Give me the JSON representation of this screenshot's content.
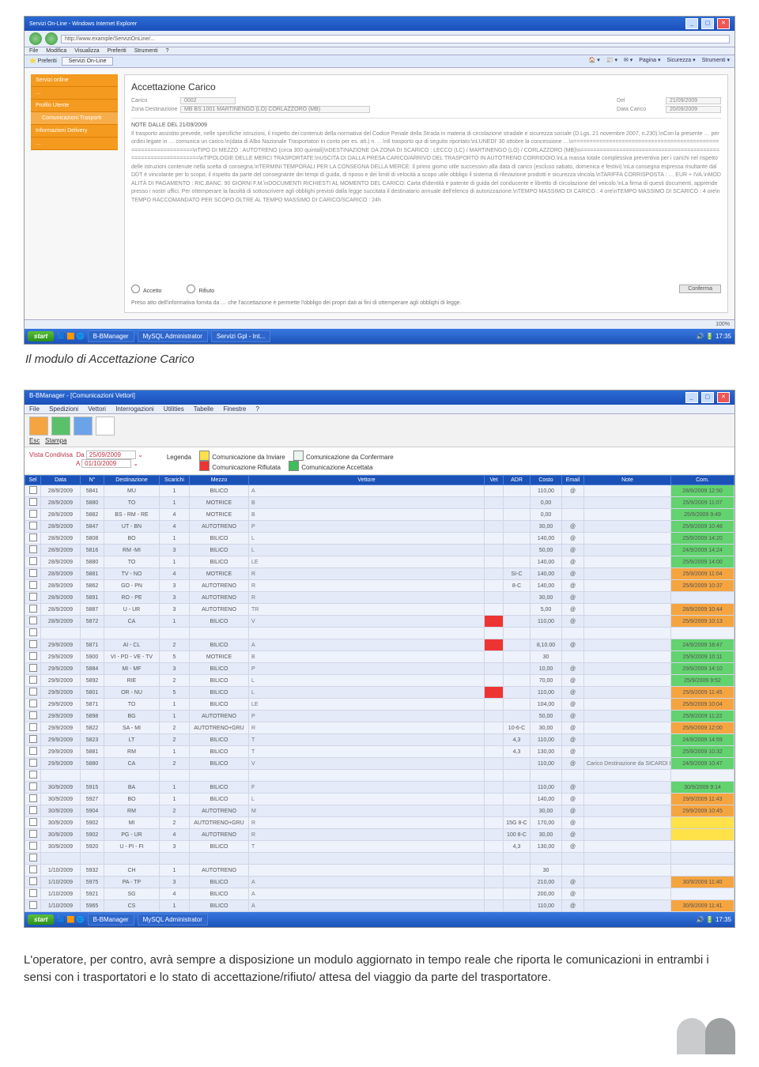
{
  "caption1": "Il modulo di Accettazione Carico",
  "bodytext": "L'operatore, per contro, avrà sempre a disposizione un modulo aggiornato in tempo reale che riporta le comunicazioni in entrambi i sensi con i trasportatori e lo stato di accettazione/rifiuto/ attesa del viaggio da parte del trasportatore.",
  "ie": {
    "title": "Servizi On-Line - Windows Internet Explorer",
    "address": "http://www.example/ServiziOnLine/...",
    "menu": [
      "File",
      "Modifica",
      "Visualizza",
      "Preferiti",
      "Strumenti",
      "?"
    ],
    "tab": "Servizi On-Line",
    "toolbar_right": [
      "Pagina ▾",
      "Sicurezza ▾",
      "Strumenti ▾"
    ],
    "status": "100%"
  },
  "sidebar": {
    "items": [
      {
        "label": "Servizi online"
      },
      {
        "label": "…"
      },
      {
        "label": "Profilo Utente"
      },
      {
        "label": "Comunicazioni Trasporti",
        "sub": true
      },
      {
        "label": "Informazioni Delivery"
      },
      {
        "label": "…"
      }
    ]
  },
  "accett": {
    "heading": "Accettazione Carico",
    "fields": {
      "carico_lbl": "Carico",
      "carico_val": "0002",
      "del_lbl": "Del",
      "del_val": "21/09/2009",
      "zona_lbl": "Zona Destinazione",
      "zona_val": "MB BS  1001  MARTINENGO  (LO)  CORLAZZORO (MB)",
      "data_lbl": "Data Carico",
      "data_val": "20/09/2009"
    },
    "note_title": "NOTE DALLE DEL 21/09/2009",
    "note_body": "Il trasporto assistito prevede, nelle specifiche istruzioni, il rispetto dei contenuti della normativa del Codice Penale della Strada in materia di circolazione stradale e sicurezza sociale (D.Lgs. 21 novembre 2007, n.230).\\nCon la presente … per ordini legate in … comunica un carico.\\n(data di Albo Nazionale Trasportatori in conto per es. att.) n. …\\nIl trasporto qui di seguito riportato:\\nLUNEDI' 30 ottobre la concessione …\\n================================================================\\nTIPO DI MEZZO : AUTOTRENO (circa 300 quintali)\\nDESTINAZIONE DA ZONA DI SCARICO : LECCO (LC) / MARTINENGO (LO) / CORLAZZORO (MB)\\n================================================================\\nTIPOLOGIE DELLE MERCI TRASPORTATE:\\nUSCITA DI DALLA PRESA CARICO/ARRIVO DEL TRASPORTO IN AUTOTRENO CORRIDOIO.\\nLa massa totale complessiva preventiva per i carichi nel rispetto delle istruzioni contenute nella scelta di consegna.\\nTERMINI TEMPORALI PER LA CONSEGNA DELLA MERCE: Il primo giorno utile successivo alla data di carico (escluso sabato, domenica e festivi).\\nLa consegna espressa risultante dal DDT è vincolante per lo scopo; il rispetto da parte del consegnante dei tempi di guida, di riposo e dei limiti di velocità a scopo utile obbligo il sistema di rilevazione prodotti e sicurezza vincola.\\nTARIFFA CORRISPOSTA : … EUR + IVA.\\nMODALITÀ DI PAGAMENTO : RIC.BANC. 90 GIORNI F.M.\\nDOCUMENTI RICHIESTI AL MOMENTO DEL CARICO: Carta d'identità e patente di guida del conducente e libretto di circolazione del veicolo.\\nLa firma di questi documenti, apprende presso i nostri uffici. Per ottemperare la facoltà di sottoscrivere agli obblighi previsti dalla legge succitata il destinatario annuale dell'elenco di autorizzazione.\\nTEMPO MASSIMO DI CARICO : 4 ore\\nTEMPO MASSIMO DI SCARICO : 4 ore\\nTEMPO RACCOMANDATO PER SCOPO OLTRE AL TEMPO MASSIMO DI CARICO/SCARICO : 24h",
    "radio_accept": "Accetto",
    "radio_reject": "Rifiuto",
    "confirm_btn": "Conferma",
    "privacy": "Preso atto dell'informativa fornita da … che l'accettazione è permette l'obbligo dei propri dati ai fini di ottemperare agli obblighi di legge."
  },
  "taskbar": {
    "start": "start",
    "items": [
      "B-BManager",
      "MySQL Administrator",
      "Servizi Gpl - Int..."
    ],
    "clock": "17:35"
  },
  "app": {
    "title": "B-BManager - [Comunicazioni Vettori]",
    "menu": [
      "File",
      "Spedizioni",
      "Vettori",
      "Interrogazioni",
      "Utilities",
      "Tabelle",
      "Finestre",
      "?"
    ],
    "esc": "Esc",
    "stampa": "Stampa",
    "filter": {
      "label": "Vista Condivisa",
      "da": "Da",
      "da_val": "25/09/2009",
      "a": "A",
      "a_val": "01/10/2009",
      "legend_lbl": "Legenda",
      "leg1": "Comunicazione da Inviare",
      "leg2": "Comunicazione da Confermare",
      "leg3": "Comunicazione Rifiutata",
      "leg4": "Comunicazione Accettata"
    },
    "columns": [
      "Sel",
      "Data",
      "N°",
      "Destinazione",
      "Scarichi",
      "Mezzo",
      "Vettore",
      "Vet",
      "ADR",
      "Costo",
      "Email",
      "Note",
      "Com."
    ],
    "rows": [
      {
        "d": "28/9/2009",
        "n": "5841",
        "dest": "MU",
        "s": "1",
        "m": "BILICO",
        "v": "A",
        "cost": "110,00",
        "email": "@",
        "com": "28/9/2009 12:50",
        "cs": "green",
        "vs": ""
      },
      {
        "d": "28/9/2009",
        "n": "5880",
        "dest": "TO",
        "s": "1",
        "m": "MOTRICE",
        "v": "B",
        "cost": "0,00",
        "email": "",
        "com": "25/9/2009 11:07",
        "cs": "green",
        "vs": ""
      },
      {
        "d": "28/9/2009",
        "n": "5882",
        "dest": "BS - RM - RE",
        "s": "4",
        "m": "MOTRICE",
        "v": "B",
        "cost": "0,00",
        "email": "",
        "com": "25/9/2009 9:49",
        "cs": "green",
        "vs": ""
      },
      {
        "d": "28/9/2009",
        "n": "5847",
        "dest": "UT - BN",
        "s": "4",
        "m": "AUTOTRENO",
        "v": "P",
        "cost": "30,00",
        "email": "@",
        "com": "25/9/2009 10:48",
        "cs": "green",
        "vs": ""
      },
      {
        "d": "28/9/2009",
        "n": "5808",
        "dest": "BO",
        "s": "1",
        "m": "BILICO",
        "v": "L",
        "cost": "140,00",
        "email": "@",
        "com": "25/9/2009 14:20",
        "cs": "green",
        "vs": ""
      },
      {
        "d": "28/9/2009",
        "n": "5816",
        "dest": "RM -MI",
        "s": "3",
        "m": "BILICO",
        "v": "L",
        "cost": "50,00",
        "email": "@",
        "com": "24/9/2009 14:24",
        "cs": "green",
        "vs": ""
      },
      {
        "d": "28/9/2009",
        "n": "5880",
        "dest": "TO",
        "s": "1",
        "m": "BILICO",
        "v": "LE",
        "cost": "140,00",
        "email": "@",
        "com": "25/9/2009 14:00",
        "cs": "green",
        "vs": ""
      },
      {
        "d": "28/9/2009",
        "n": "5881",
        "dest": "TV - NO",
        "s": "4",
        "m": "MOTRICE",
        "v": "R",
        "adr": "SI-C",
        "cost": "140,00",
        "email": "@",
        "com": "25/9/2009 11:04",
        "cs": "orange",
        "vs": ""
      },
      {
        "d": "28/9/2009",
        "n": "5862",
        "dest": "GO - PN",
        "s": "3",
        "m": "AUTOTRENO",
        "v": "R",
        "adr": "8-C",
        "cost": "140,00",
        "email": "@",
        "com": "25/9/2009 10:37",
        "cs": "orange",
        "vs": ""
      },
      {
        "d": "28/9/2009",
        "n": "5891",
        "dest": "RO - PE",
        "s": "3",
        "m": "AUTOTRENO",
        "v": "R",
        "cost": "30,00",
        "email": "@",
        "com": "",
        "cs": "",
        "vs": ""
      },
      {
        "d": "28/9/2009",
        "n": "5887",
        "dest": "U - UR",
        "s": "3",
        "m": "AUTOTRENO",
        "v": "TR",
        "cost": "5,00",
        "email": "@",
        "com": "28/9/2009 10:44",
        "cs": "orange",
        "vs": ""
      },
      {
        "d": "28/9/2009",
        "n": "5872",
        "dest": "CA",
        "s": "1",
        "m": "BILICO",
        "v": "V",
        "cost": "110,00",
        "email": "@",
        "com": "25/9/2009 10:13",
        "cs": "orange",
        "vs": "red"
      },
      {
        "sep": true
      },
      {
        "d": "29/9/2009",
        "n": "5871",
        "dest": "AI - CL",
        "s": "2",
        "m": "BILICO",
        "v": "A",
        "cost": "8,10.00",
        "email": "@",
        "com": "24/9/2009 18:47",
        "cs": "green",
        "vs": "red"
      },
      {
        "d": "29/9/2009",
        "n": "5900",
        "dest": "VI - PD - VE - TV",
        "s": "5",
        "m": "MOTRICE",
        "v": "B",
        "cost": "30",
        "email": "",
        "com": "25/9/2009 10:11",
        "cs": "green",
        "vs": ""
      },
      {
        "d": "29/9/2009",
        "n": "5884",
        "dest": "MI - MF",
        "s": "3",
        "m": "BILICO",
        "v": "P",
        "cost": "10,00",
        "email": "@",
        "com": "29/9/2009 14:10",
        "cs": "green",
        "vs": ""
      },
      {
        "d": "29/9/2009",
        "n": "5892",
        "dest": "RIE",
        "s": "2",
        "m": "BILICO",
        "v": "L",
        "cost": "70,00",
        "email": "@",
        "com": "25/9/2009 9:52",
        "cs": "green",
        "vs": ""
      },
      {
        "d": "29/9/2009",
        "n": "5801",
        "dest": "OR - NU",
        "s": "5",
        "m": "BILICO",
        "v": "L",
        "cost": "110,00",
        "email": "@",
        "com": "25/9/2009 11:45",
        "cs": "orange",
        "vs": "red"
      },
      {
        "d": "29/9/2009",
        "n": "5871",
        "dest": "TO",
        "s": "1",
        "m": "BILICO",
        "v": "LE",
        "cost": "104,00",
        "email": "@",
        "com": "25/9/2009 10:04",
        "cs": "orange",
        "vs": ""
      },
      {
        "d": "29/9/2009",
        "n": "5898",
        "dest": "BG",
        "s": "1",
        "m": "AUTOTRENO",
        "v": "P",
        "cost": "50,00",
        "email": "@",
        "com": "25/9/2009 11:22",
        "cs": "green",
        "vs": ""
      },
      {
        "d": "29/9/2009",
        "n": "5822",
        "dest": "SA - MI",
        "s": "2",
        "m": "AUTOTRENO+GRU",
        "v": "R",
        "adr": "10-6-C",
        "cost": "30,00",
        "email": "@",
        "com": "25/9/2009 12:00",
        "cs": "orange",
        "vs": ""
      },
      {
        "d": "29/9/2009",
        "n": "5823",
        "dest": "LT",
        "s": "2",
        "m": "BILICO",
        "v": "T",
        "adr": "4,3",
        "cost": "110,00",
        "email": "@",
        "com": "24/9/2009 14:59",
        "cs": "green",
        "vs": ""
      },
      {
        "d": "29/9/2009",
        "n": "5881",
        "dest": "RM",
        "s": "1",
        "m": "BILICO",
        "v": "T",
        "adr": "4,3",
        "cost": "130,00",
        "email": "@",
        "com": "25/9/2009 10:32",
        "cs": "green",
        "vs": ""
      },
      {
        "d": "29/9/2009",
        "n": "5880",
        "dest": "CA",
        "s": "2",
        "m": "BILICO",
        "v": "V",
        "cost": "110,00",
        "email": "@",
        "note": "Carico Destinazione da SICARDI R c…",
        "com": "24/9/2009 10:47",
        "cs": "green",
        "vs": ""
      },
      {
        "sep": true
      },
      {
        "d": "30/9/2009",
        "n": "5915",
        "dest": "BA",
        "s": "1",
        "m": "BILICO",
        "v": "F",
        "cost": "110,00",
        "email": "@",
        "com": "30/9/2009 9:14",
        "cs": "green",
        "vs": ""
      },
      {
        "d": "30/9/2009",
        "n": "5927",
        "dest": "BO",
        "s": "1",
        "m": "BILICO",
        "v": "L",
        "cost": "140,00",
        "email": "@",
        "com": "29/9/2009 11:43",
        "cs": "orange",
        "vs": ""
      },
      {
        "d": "30/9/2009",
        "n": "5904",
        "dest": "RM",
        "s": "2",
        "m": "AUTOTRENO",
        "v": "M",
        "cost": "30,00",
        "email": "@",
        "com": "29/9/2009 10:45",
        "cs": "orange",
        "vs": ""
      },
      {
        "d": "30/9/2009",
        "n": "5902",
        "dest": "MI",
        "s": "2",
        "m": "AUTOTRENO+GRU",
        "v": "R",
        "adr": "15G 8-C",
        "cost": "170,00",
        "email": "@",
        "com": "",
        "cs": "yellow",
        "vs": ""
      },
      {
        "d": "30/9/2009",
        "n": "5902",
        "dest": "PG - UR",
        "s": "4",
        "m": "AUTOTRENO",
        "v": "R",
        "adr": "100 8-C",
        "cost": "30,00",
        "email": "@",
        "com": "",
        "cs": "yellow",
        "vs": ""
      },
      {
        "d": "30/9/2009",
        "n": "5920",
        "dest": "U - PI - FI",
        "s": "3",
        "m": "BILICO",
        "v": "T",
        "adr": "4,3",
        "cost": "130,00",
        "email": "@",
        "com": "",
        "cs": "",
        "vs": ""
      },
      {
        "sep": true
      },
      {
        "d": "1/10/2009",
        "n": "5932",
        "dest": "CH",
        "s": "1",
        "m": "AUTOTRENO",
        "v": "",
        "cost": "30",
        "email": "",
        "com": "",
        "cs": "",
        "vs": ""
      },
      {
        "d": "1/10/2009",
        "n": "5975",
        "dest": "PA - TP",
        "s": "3",
        "m": "BILICO",
        "v": "A",
        "cost": "210,00",
        "email": "@",
        "com": "30/9/2009 11:40",
        "cs": "orange",
        "vs": ""
      },
      {
        "d": "1/10/2009",
        "n": "5921",
        "dest": "SG",
        "s": "4",
        "m": "BILICO",
        "v": "A",
        "cost": "200,00",
        "email": "@",
        "com": "",
        "cs": "",
        "vs": ""
      },
      {
        "d": "1/10/2009",
        "n": "5965",
        "dest": "CS",
        "s": "1",
        "m": "BILICO",
        "v": "A",
        "cost": "110,00",
        "email": "@",
        "com": "30/9/2009 11:41",
        "cs": "orange",
        "vs": ""
      }
    ]
  }
}
